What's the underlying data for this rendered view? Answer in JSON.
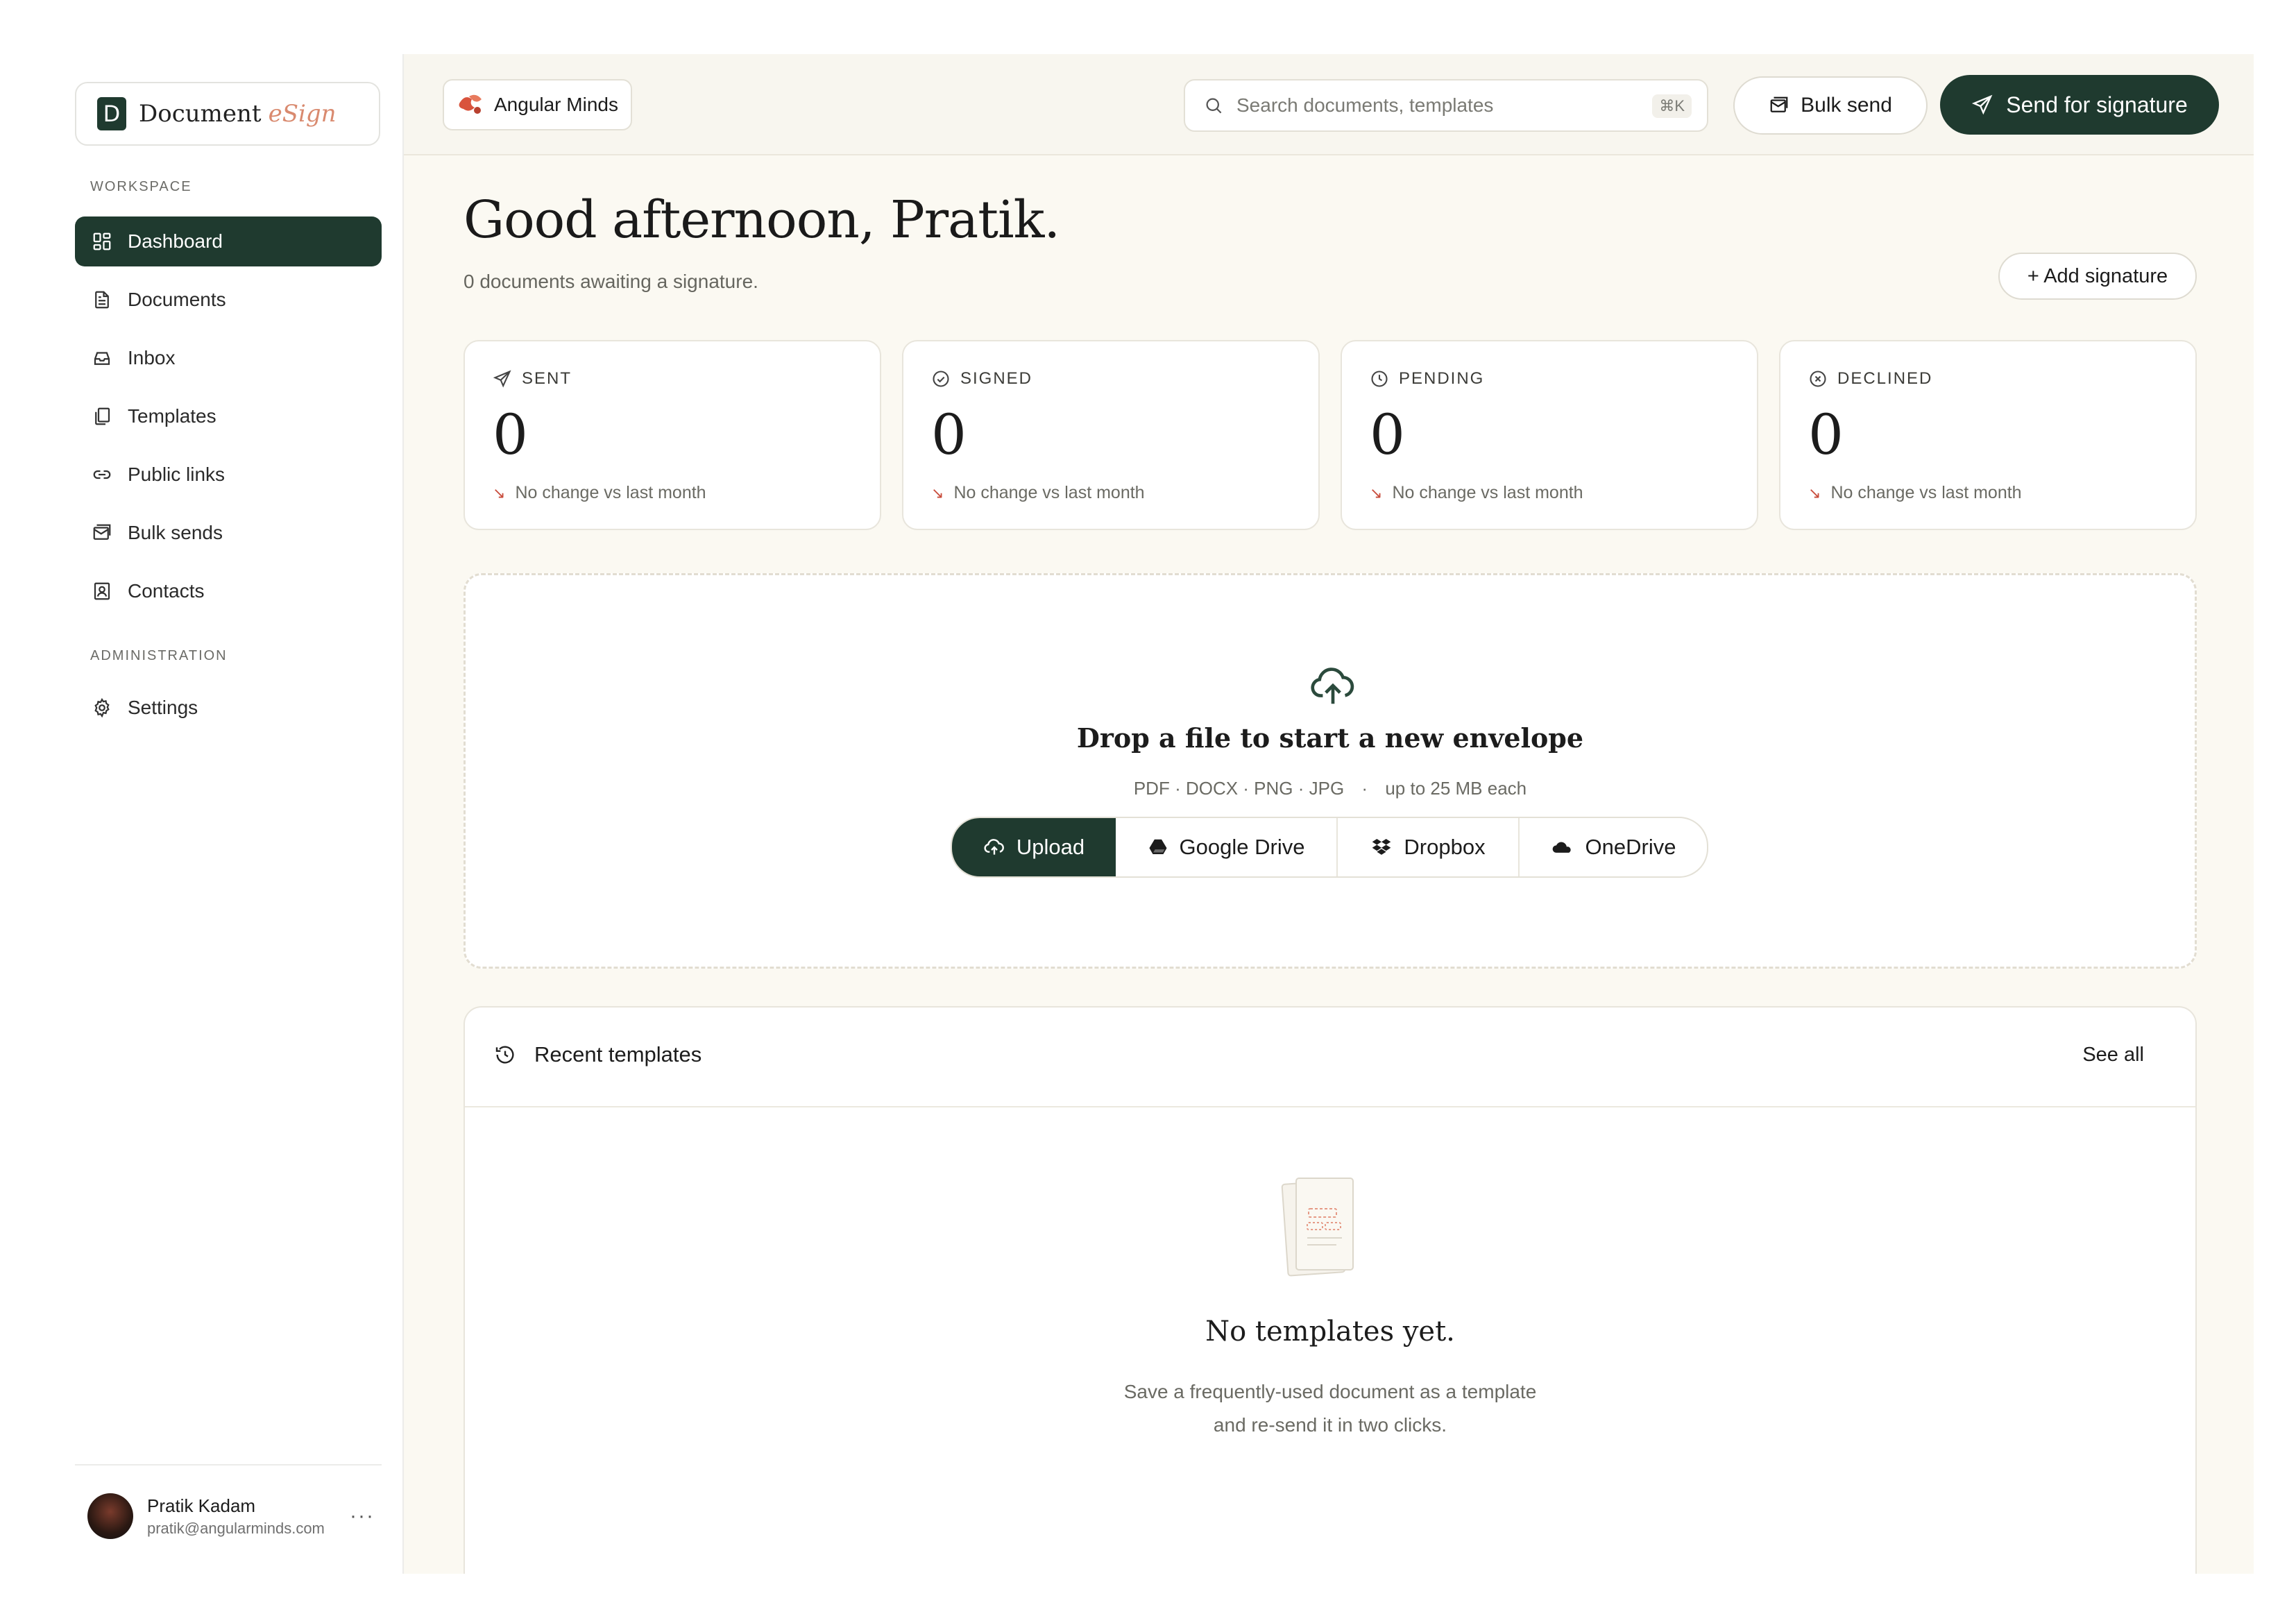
{
  "app": {
    "brand_name": "Document",
    "brand_accent": "eSign",
    "brand_initial": "D"
  },
  "sidebar": {
    "workspace_label": "WORKSPACE",
    "admin_label": "ADMINISTRATION",
    "items": [
      {
        "label": "Dashboard",
        "icon": "dashboard-icon",
        "active": true
      },
      {
        "label": "Documents",
        "icon": "document-icon"
      },
      {
        "label": "Inbox",
        "icon": "inbox-icon"
      },
      {
        "label": "Templates",
        "icon": "templates-icon"
      },
      {
        "label": "Public links",
        "icon": "link-icon"
      },
      {
        "label": "Bulk sends",
        "icon": "bulk-send-icon"
      },
      {
        "label": "Contacts",
        "icon": "contacts-icon"
      }
    ],
    "admin_items": [
      {
        "label": "Settings",
        "icon": "gear-icon"
      }
    ],
    "user": {
      "name": "Pratik Kadam",
      "email": "pratik@angularminds.com",
      "more": "···"
    }
  },
  "topbar": {
    "org_name": "Angular Minds",
    "search_placeholder": "Search documents, templates",
    "search_shortcut": "⌘K",
    "bulk_send_label": "Bulk send",
    "send_label": "Send for signature"
  },
  "header": {
    "greeting": "Good afternoon, Pratik.",
    "subtitle": "0 documents awaiting a signature.",
    "add_signature_label": "+ Add signature"
  },
  "stats": [
    {
      "label": "SENT",
      "value": "0",
      "change": "No change vs last month",
      "icon": "send-icon"
    },
    {
      "label": "SIGNED",
      "value": "0",
      "change": "No change vs last month",
      "icon": "check-circle-icon"
    },
    {
      "label": "PENDING",
      "value": "0",
      "change": "No change vs last month",
      "icon": "clock-icon"
    },
    {
      "label": "DECLINED",
      "value": "0",
      "change": "No change vs last month",
      "icon": "x-circle-icon"
    }
  ],
  "dropzone": {
    "title": "Drop a file to start a new envelope",
    "formats": "PDF · DOCX · PNG · JPG",
    "separator": "·",
    "limit": "up to 25 MB each",
    "sources": [
      {
        "label": "Upload",
        "icon": "upload-cloud-icon"
      },
      {
        "label": "Google Drive",
        "icon": "google-drive-icon"
      },
      {
        "label": "Dropbox",
        "icon": "dropbox-icon"
      },
      {
        "label": "OneDrive",
        "icon": "onedrive-icon"
      }
    ]
  },
  "recent_templates": {
    "title": "Recent templates",
    "see_all": "See all",
    "empty_title": "No templates yet.",
    "empty_desc_line1": "Save a frequently-used document as a template",
    "empty_desc_line2": "and re-send it in two clicks."
  },
  "colors": {
    "accent": "#1f3a2f",
    "brand_accent": "#d98a6f",
    "decline_arrow": "#c84b3a",
    "page_bg": "#fbf9f2"
  }
}
